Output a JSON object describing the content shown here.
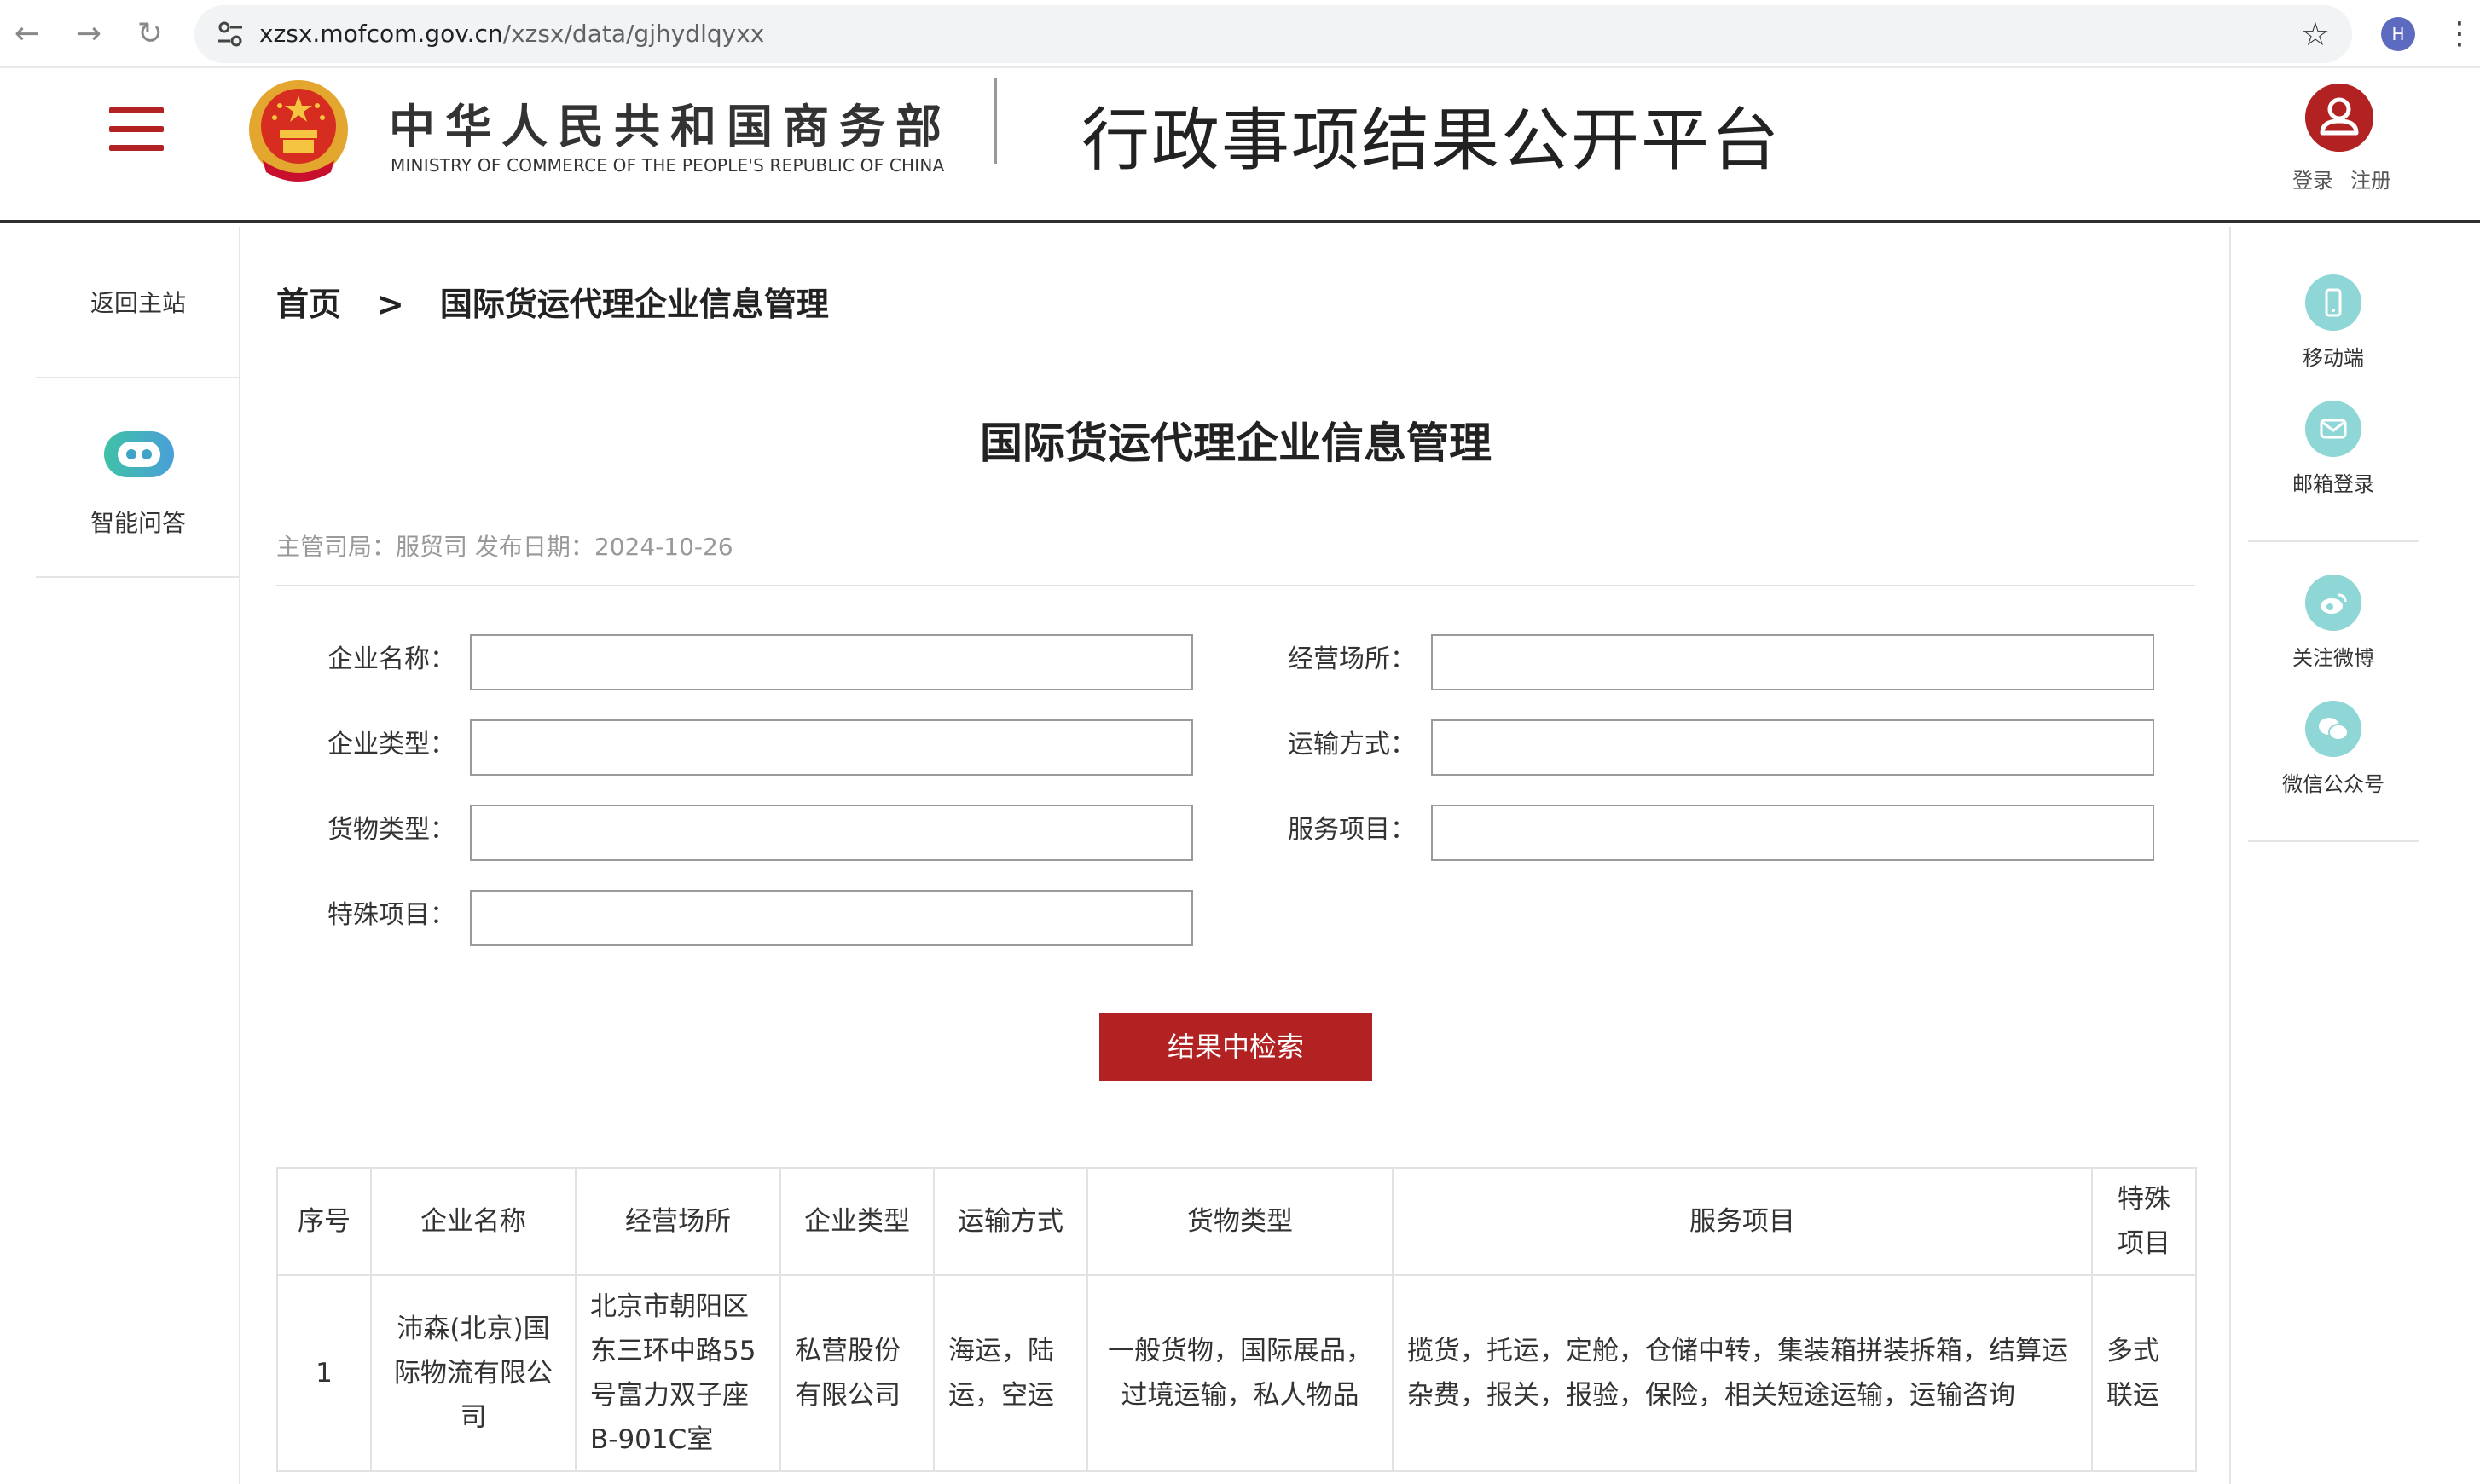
{
  "browser": {
    "url_host": "xzsx.mofcom.gov.cn",
    "url_path": "/xzsx/data/gjhydlqyxx",
    "profile_initial": "H",
    "icons": [
      "back-icon",
      "forward-icon",
      "reload-icon",
      "tune-icon",
      "star-icon",
      "kebab-menu-icon"
    ]
  },
  "header": {
    "ministry_cn": "中华人民共和国商务部",
    "ministry_en": "MINISTRY OF COMMERCE OF THE PEOPLE'S REPUBLIC OF CHINA",
    "platform_title": "行政事项结果公开平台",
    "login": "登录",
    "register": "注册",
    "accent_color": "#b22222"
  },
  "left_sidebar": {
    "back_home": "返回主站",
    "ai_qa": "智能问答"
  },
  "right_sidebar": {
    "items": [
      {
        "label": "移动端",
        "icon": "mobile-icon"
      },
      {
        "label": "邮箱登录",
        "icon": "mail-icon"
      },
      {
        "label": "关注微博",
        "icon": "weibo-icon"
      },
      {
        "label": "微信公众号",
        "icon": "wechat-icon"
      }
    ]
  },
  "breadcrumb": {
    "home": "首页",
    "separator": ">",
    "current": "国际货运代理企业信息管理"
  },
  "main": {
    "title": "国际货运代理企业信息管理",
    "meta": "主管司局：服贸司 发布日期：2024-10-26"
  },
  "form": {
    "company_name": {
      "label": "企业名称：",
      "value": ""
    },
    "business_place": {
      "label": "经营场所：",
      "value": ""
    },
    "company_type": {
      "label": "企业类型：",
      "value": ""
    },
    "transport_mode": {
      "label": "运输方式：",
      "value": ""
    },
    "cargo_type": {
      "label": "货物类型：",
      "value": ""
    },
    "service_items": {
      "label": "服务项目：",
      "value": ""
    },
    "special_items": {
      "label": "特殊项目：",
      "value": ""
    },
    "search_button": "结果中检索"
  },
  "table": {
    "headers": [
      "序号",
      "企业名称",
      "经营场所",
      "企业类型",
      "运输方式",
      "货物类型",
      "服务项目",
      "特殊项目"
    ],
    "rows": [
      [
        "1",
        "沛森(北京)国际物流有限公司",
        "北京市朝阳区东三环中路55号富力双子座B-901C室",
        "私营股份有限公司",
        "海运，陆运，空运",
        "一般货物，国际展品，过境运输，私人物品",
        "揽货，托运，定舱，仓储中转，集装箱拼装拆箱，结算运杂费，报关，报验，保险，相关短途运输，运输咨询",
        "多式联运"
      ]
    ]
  }
}
